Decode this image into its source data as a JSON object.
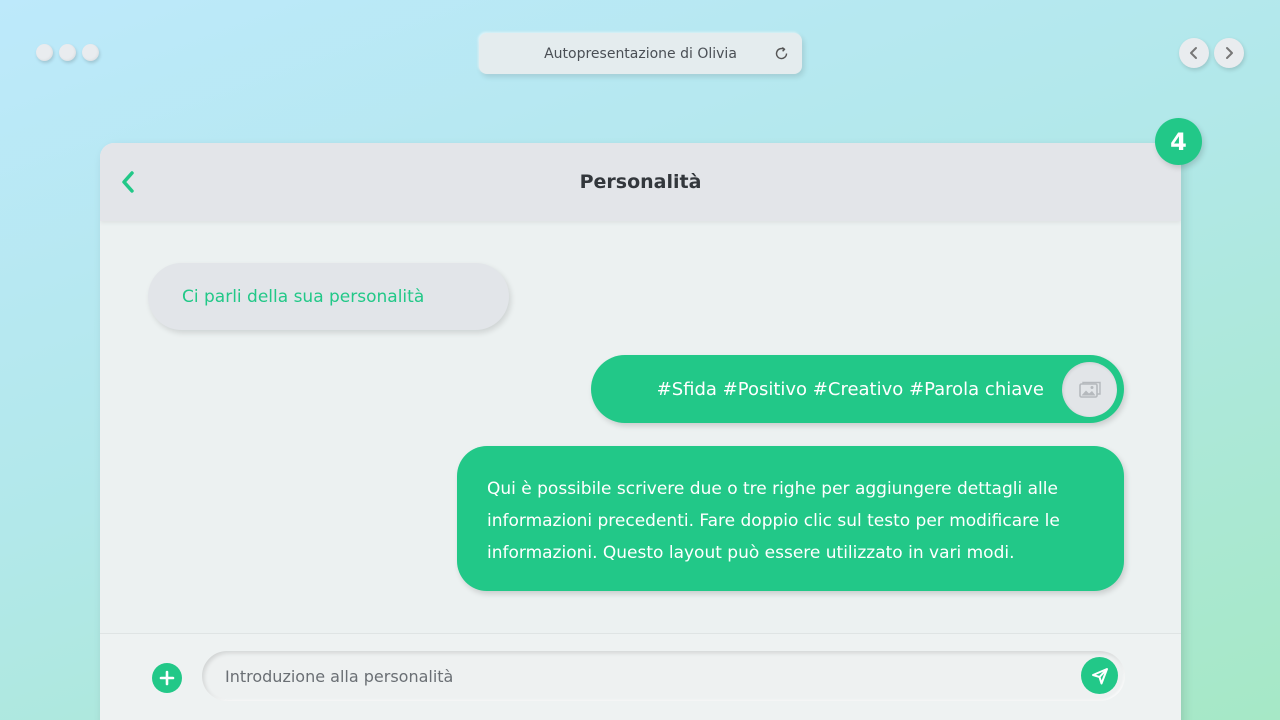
{
  "window": {
    "title": "Autopresentazione di Olivia"
  },
  "icons": {
    "refresh": "refresh-icon",
    "prev": "chevron-left-icon",
    "next": "chevron-right-icon",
    "back": "back-arrow-icon",
    "image": "image-icon",
    "add": "plus-icon",
    "send": "send-icon"
  },
  "colors": {
    "accent": "#22c888",
    "header_bg": "#e3e5e9",
    "card_bg": "#ecf1f1"
  },
  "step_badge": "4",
  "card": {
    "title": "Personalità"
  },
  "messages": {
    "question": "Ci parli della sua personalità",
    "tags": "#Sfida #Positivo #Creativo #Parola chiave",
    "description": "Qui è possibile scrivere due o tre righe per aggiungere dettagli alle informazioni precedenti. Fare doppio clic sul testo per modificare le informazioni. Questo layout può essere utilizzato in vari modi."
  },
  "composer": {
    "placeholder": "Introduzione alla personalità",
    "value": ""
  }
}
